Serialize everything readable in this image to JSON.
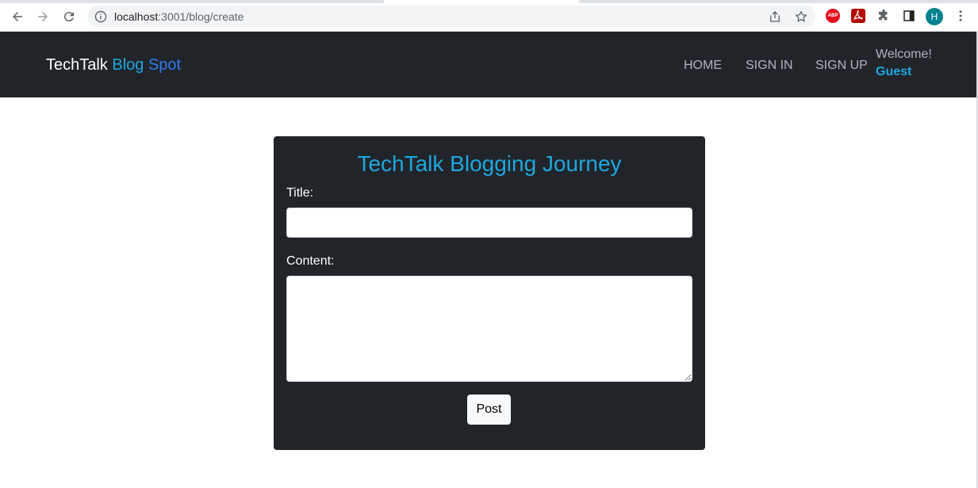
{
  "browser": {
    "url_host": "localhost",
    "url_path": ":3001/blog/create",
    "avatar_letter": "H",
    "abp_label": "ABP"
  },
  "navbar": {
    "brand_part1": "TechTalk ",
    "brand_part2": "Blog ",
    "brand_part3": "Spot",
    "links": [
      "HOME",
      "SIGN IN",
      "SIGN UP"
    ],
    "welcome": "Welcome!",
    "user": "Guest"
  },
  "form": {
    "heading": "TechTalk Blogging Journey",
    "title_label": "Title:",
    "title_value": "",
    "content_label": "Content:",
    "content_value": "",
    "submit_label": "Post"
  },
  "colors": {
    "accent": "#1ea7e1",
    "navbar_bg": "#212529",
    "card_bg": "#212529"
  }
}
